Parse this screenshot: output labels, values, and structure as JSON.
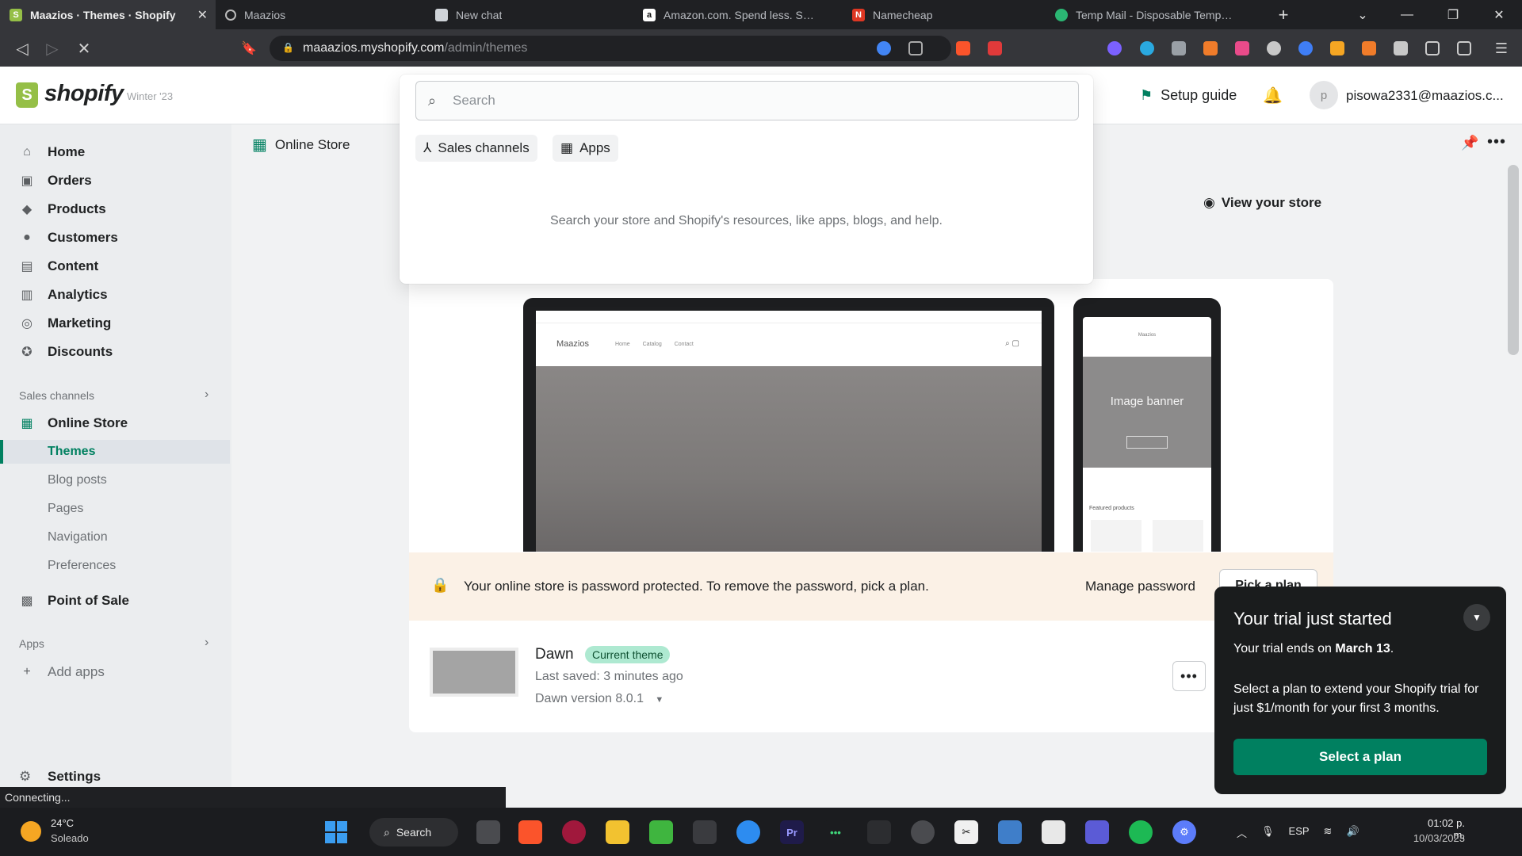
{
  "browser": {
    "tabs": [
      {
        "label": "Maazios · Themes · Shopify",
        "active": true,
        "favicon_color": "#95bf47"
      },
      {
        "label": "Maazios",
        "active": false,
        "favicon_color": "#6b6d70"
      },
      {
        "label": "New chat",
        "active": false,
        "favicon_color": "#cfd3d8"
      },
      {
        "label": "Amazon.com. Spend less. Smile",
        "active": false,
        "favicon_color": "#ffffff"
      },
      {
        "label": "Namecheap",
        "active": false,
        "favicon_color": "#de3723"
      },
      {
        "label": "Temp Mail - Disposable Tempor...",
        "active": false,
        "favicon_color": "#2bb673"
      }
    ],
    "url_host": "maaazios.myshopify.com",
    "url_path": "/admin/themes",
    "status": "Connecting..."
  },
  "topbar": {
    "logo_text": "shopify",
    "logo_badge": "Winter '23",
    "setup_guide": "Setup guide",
    "avatar_initial": "p",
    "account": "pisowa2331@maazios.c..."
  },
  "sidebar": {
    "items": [
      {
        "label": "Home",
        "icon": "home-icon"
      },
      {
        "label": "Orders",
        "icon": "orders-icon"
      },
      {
        "label": "Products",
        "icon": "tag-icon"
      },
      {
        "label": "Customers",
        "icon": "person-icon"
      },
      {
        "label": "Content",
        "icon": "content-icon"
      },
      {
        "label": "Analytics",
        "icon": "chart-icon"
      },
      {
        "label": "Marketing",
        "icon": "target-icon"
      },
      {
        "label": "Discounts",
        "icon": "discount-icon"
      }
    ],
    "sales_channels_heading": "Sales channels",
    "online_store": "Online Store",
    "online_store_sub": [
      "Themes",
      "Blog posts",
      "Pages",
      "Navigation",
      "Preferences"
    ],
    "point_of_sale": "Point of Sale",
    "apps_heading": "Apps",
    "add_apps": "Add apps",
    "settings": "Settings"
  },
  "main": {
    "breadcrumb": "Online Store",
    "view_store": "View your store",
    "preview": {
      "desktop_store_name": "Maazios",
      "desktop_nav": "Home Catalog Contact",
      "mobile_store_name": "Maazios",
      "mobile_banner_title": "Image banner",
      "mobile_featured": "Featured products"
    },
    "password_banner": {
      "text": "Your online store is password protected. To remove the password, pick a plan.",
      "manage": "Manage password",
      "pick": "Pick a plan"
    },
    "theme": {
      "name": "Dawn",
      "badge": "Current theme",
      "saved": "Last saved: 3 minutes ago",
      "version": "Dawn version 8.0.1"
    }
  },
  "search": {
    "placeholder": "Search",
    "chips": [
      "Sales channels",
      "Apps"
    ],
    "hint": "Search your store and Shopify's resources, like apps, blogs, and help."
  },
  "trial": {
    "title": "Your trial just started",
    "ends_prefix": "Your trial ends on ",
    "ends_date": "March 13",
    "ends_suffix": ".",
    "body": "Select a plan to extend your Shopify trial for just $1/month for your first 3 months.",
    "button": "Select a plan"
  },
  "taskbar": {
    "temp": "24°C",
    "condition": "Soleado",
    "search": "Search",
    "lang": "ESP",
    "time": "01:02 p. m.",
    "date": "10/03/2023"
  },
  "colors": {
    "accent": "#008060",
    "shopify_green": "#95bf47",
    "banner_bg": "#fbf1e6",
    "badge_bg": "#aee9d1"
  }
}
